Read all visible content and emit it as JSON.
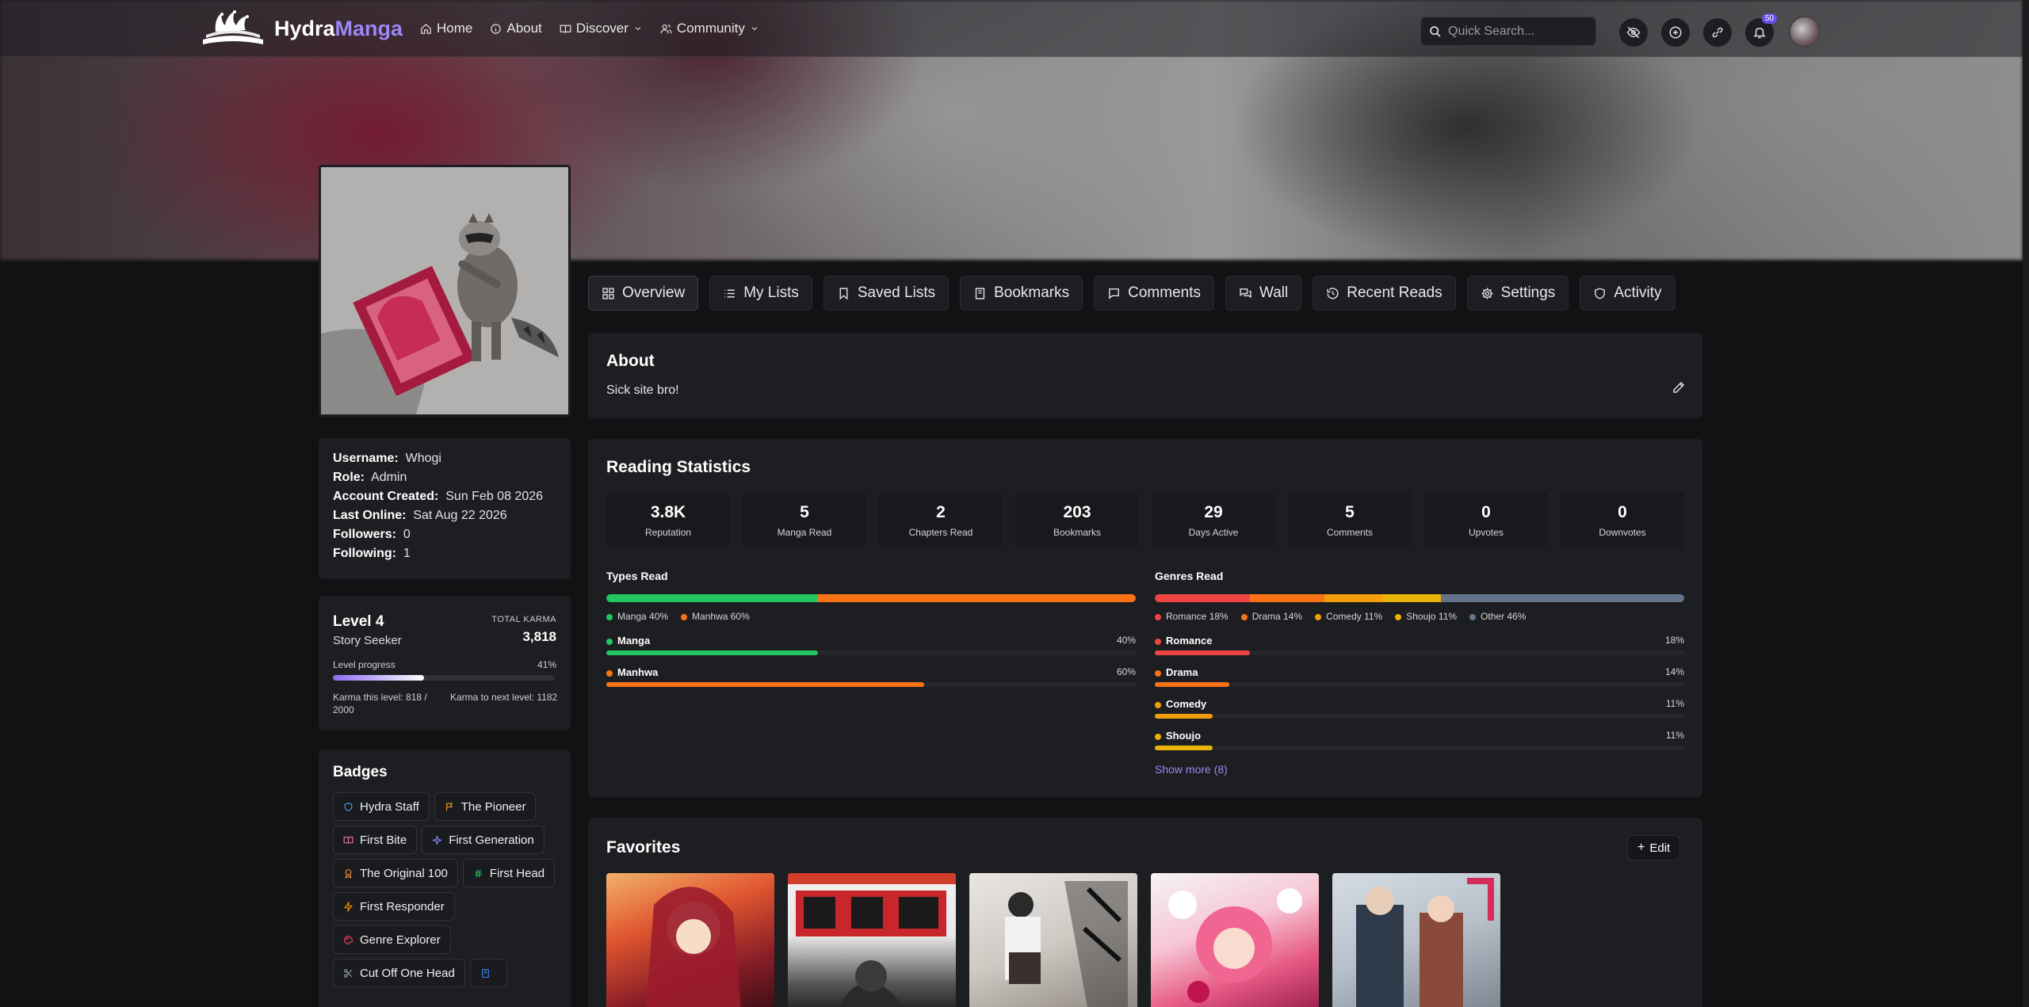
{
  "nav": {
    "logo_main": "Hydra",
    "logo_accent": "Manga",
    "links": [
      {
        "label": "Home",
        "icon": "home-icon"
      },
      {
        "label": "About",
        "icon": "info-icon"
      },
      {
        "label": "Discover",
        "icon": "book-icon"
      },
      {
        "label": "Community",
        "icon": "users-icon"
      }
    ],
    "search_placeholder": "Quick Search...",
    "notif_count": "50"
  },
  "profile": {
    "info": [
      {
        "label": "Username:",
        "value": "Whogi"
      },
      {
        "label": "Role:",
        "value": "Admin"
      },
      {
        "label": "Account Created:",
        "value": "Sun Feb 08 2026"
      },
      {
        "label": "Last Online:",
        "value": "Sat Aug 22 2026"
      },
      {
        "label": "Followers:",
        "value": "0"
      },
      {
        "label": "Following:",
        "value": "1"
      }
    ],
    "level": {
      "title": "Level 4",
      "subtitle": "Story Seeker",
      "karma_label": "TOTAL KARMA",
      "karma_value": "3,818",
      "progress_label": "Level progress",
      "progress_pct_text": "41%",
      "progress": 0.41,
      "karma_this_level": "Karma this level: 818 / 2000",
      "karma_next": "Karma to next level: 1182"
    },
    "badges_title": "Badges",
    "badges": [
      {
        "label": "Hydra Staff",
        "icon": "shield-icon",
        "color": "#4c9aff"
      },
      {
        "label": "The Pioneer",
        "icon": "flag-icon",
        "color": "#f5a524"
      },
      {
        "label": "First Bite",
        "icon": "book-open-icon",
        "color": "#f472b6"
      },
      {
        "label": "First Generation",
        "icon": "sparkle-icon",
        "color": "#818cf8"
      },
      {
        "label": "The Original 100",
        "icon": "award-icon",
        "color": "#fb923c"
      },
      {
        "label": "First Head",
        "icon": "hash-icon",
        "color": "#22c55e"
      },
      {
        "label": "First Responder",
        "icon": "bolt-icon",
        "color": "#f59e0b"
      },
      {
        "label": "Genre Explorer",
        "icon": "palette-icon",
        "color": "#f43f5e"
      },
      {
        "label": "Cut Off One Head",
        "icon": "scissors-icon",
        "color": "#9ca3af"
      },
      {
        "label": "",
        "icon": "book-icon",
        "color": "#3b82f6"
      }
    ]
  },
  "tabs": [
    {
      "label": "Overview",
      "icon": "grid-icon"
    },
    {
      "label": "My Lists",
      "icon": "list-icon"
    },
    {
      "label": "Saved Lists",
      "icon": "bookmark-icon"
    },
    {
      "label": "Bookmarks",
      "icon": "book-icon"
    },
    {
      "label": "Comments",
      "icon": "comment-icon"
    },
    {
      "label": "Wall",
      "icon": "chat-icon"
    },
    {
      "label": "Recent Reads",
      "icon": "history-icon"
    },
    {
      "label": "Settings",
      "icon": "gear-icon"
    },
    {
      "label": "Activity",
      "icon": "shield-icon"
    }
  ],
  "about": {
    "title": "About",
    "text": "Sick site bro!"
  },
  "stats": {
    "title": "Reading Statistics",
    "items": [
      {
        "value": "3.8K",
        "label": "Reputation"
      },
      {
        "value": "5",
        "label": "Manga Read"
      },
      {
        "value": "2",
        "label": "Chapters Read"
      },
      {
        "value": "203",
        "label": "Bookmarks"
      },
      {
        "value": "29",
        "label": "Days Active"
      },
      {
        "value": "5",
        "label": "Comments"
      },
      {
        "value": "0",
        "label": "Upvotes"
      },
      {
        "value": "0",
        "label": "Downvotes"
      }
    ]
  },
  "types": {
    "title": "Types Read",
    "items": [
      {
        "name": "Manga",
        "pct": 40,
        "pct_text": "40%",
        "legend": "Manga 40%",
        "color": "#22c55e"
      },
      {
        "name": "Manhwa",
        "pct": 60,
        "pct_text": "60%",
        "legend": "Manhwa 60%",
        "color": "#f97316"
      }
    ]
  },
  "genres": {
    "title": "Genres Read",
    "segments": [
      {
        "legend": "Romance 18%",
        "pct": 18,
        "color": "#ef4444"
      },
      {
        "legend": "Drama 14%",
        "pct": 14,
        "color": "#f97316"
      },
      {
        "legend": "Comedy 11%",
        "pct": 11,
        "color": "#f59e0b"
      },
      {
        "legend": "Shoujo 11%",
        "pct": 11,
        "color": "#eab308"
      },
      {
        "legend": "Other 46%",
        "pct": 46,
        "color": "#64748b"
      }
    ],
    "rows": [
      {
        "name": "Romance",
        "pct": 18,
        "pct_text": "18%",
        "color": "#ef4444"
      },
      {
        "name": "Drama",
        "pct": 14,
        "pct_text": "14%",
        "color": "#f97316"
      },
      {
        "name": "Comedy",
        "pct": 11,
        "pct_text": "11%",
        "color": "#f59e0b"
      },
      {
        "name": "Shoujo",
        "pct": 11,
        "pct_text": "11%",
        "color": "#eab308"
      }
    ],
    "show_more": "Show more (8)"
  },
  "favorites": {
    "title": "Favorites",
    "edit_label": "Edit"
  }
}
